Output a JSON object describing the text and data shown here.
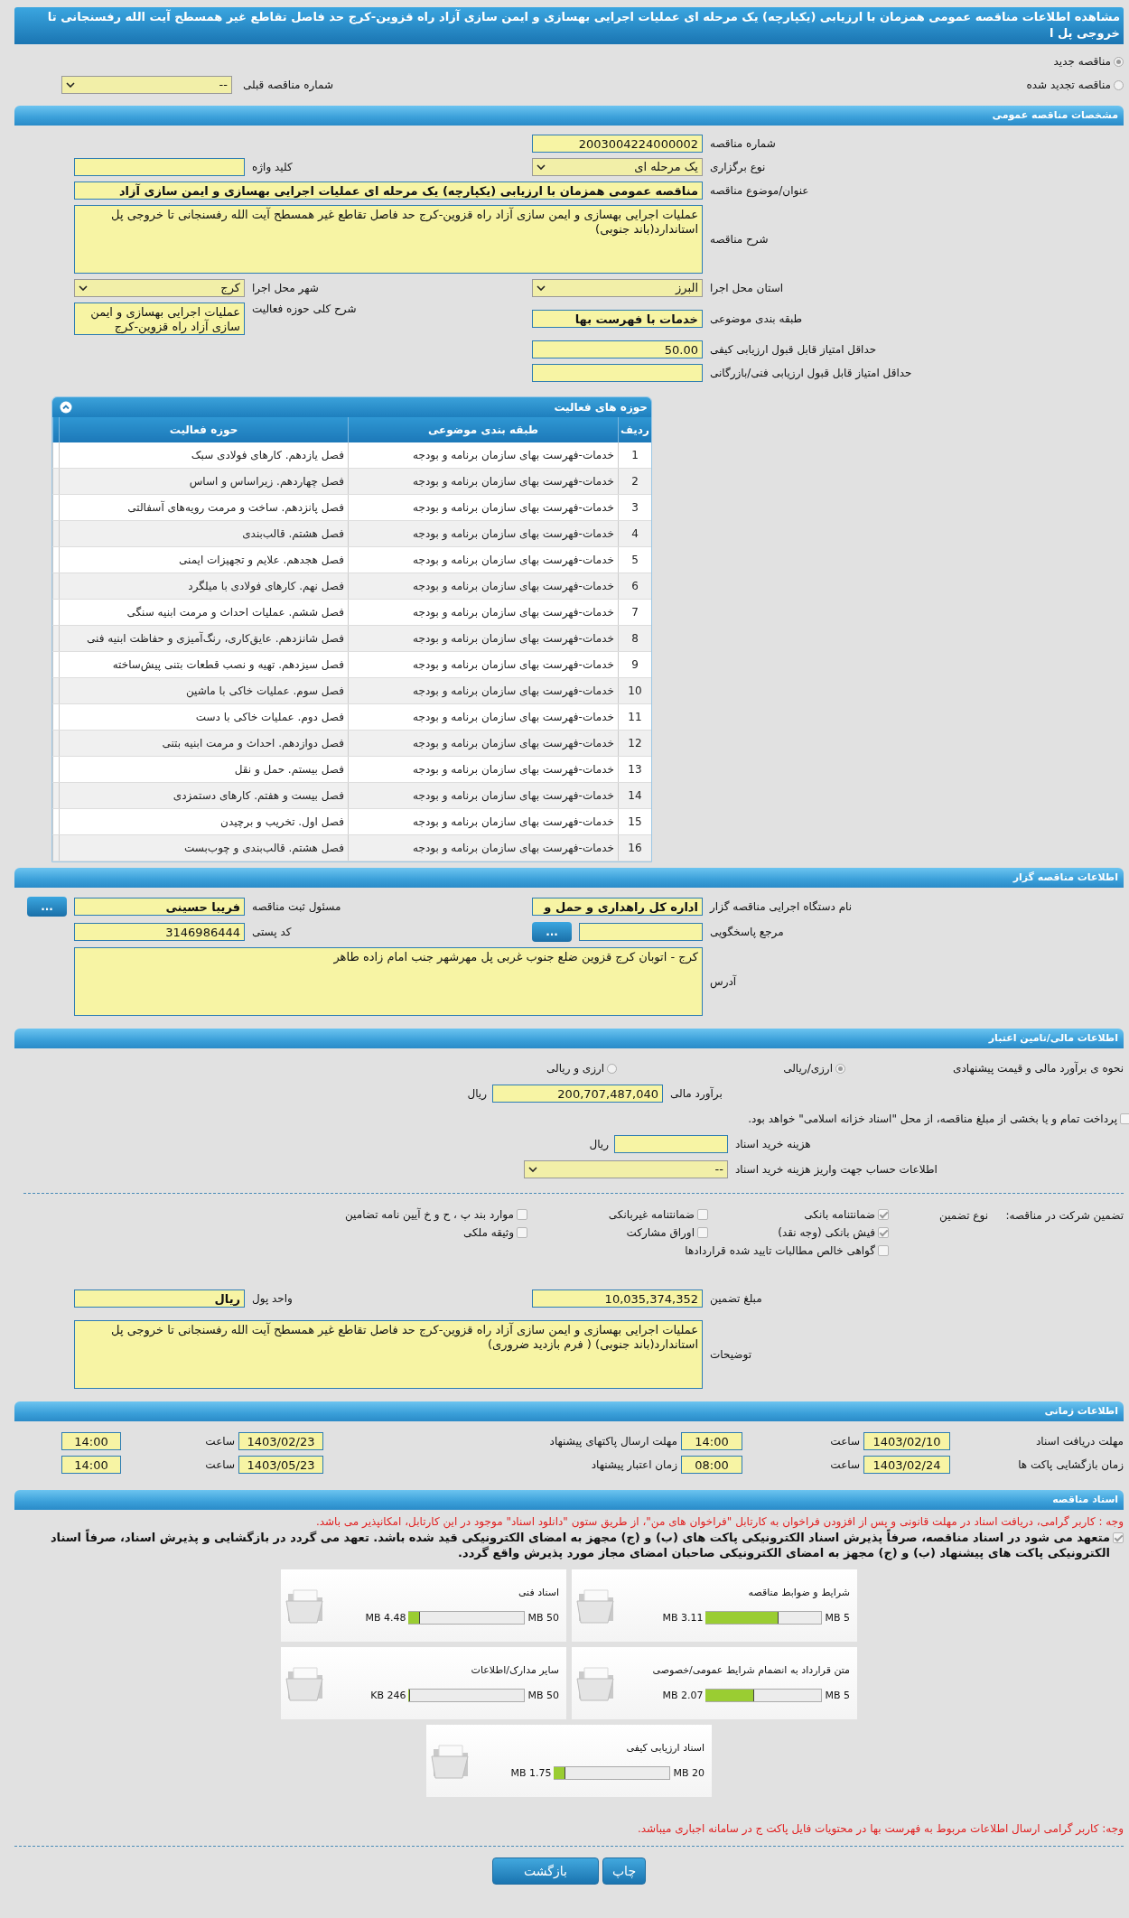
{
  "title": "مشاهده اطلاعات مناقصه عمومی همزمان با ارزیابی (یکپارچه) یک مرحله ای عملیات اجرایی بهسازی و ایمن سازی آزاد راه قزوین-کرج حد فاصل تقاطع غیر همسطح آیت الله رفسنجانی تا خروجی پل ا",
  "tender_kind": [
    {
      "label": "مناقصه جدید",
      "selected": true
    },
    {
      "label": "مناقصه تجدید شده",
      "selected": false
    }
  ],
  "previous_tender": {
    "label": "شماره مناقصه قبلی",
    "value": "--"
  },
  "general": {
    "title": "مشخصات مناقصه عمومی",
    "rows": [
      [
        {
          "kind": "text",
          "label": "شماره مناقصه",
          "value": "2003004224000002"
        }
      ],
      [
        {
          "kind": "select",
          "label": "نوع برگزاری",
          "value": "یک مرحله ای"
        },
        {
          "kind": "text",
          "label": "کلید واژه"
        }
      ],
      [
        {
          "kind": "wide",
          "label": "عنوان/موضوع مناقصه",
          "value": "مناقصه عمومی همزمان با ارزیابی (یکپارچه) یک مرحله ای عملیات اجرایی بهسازی و ایمن سازی آزاد",
          "bold": true
        }
      ],
      [
        {
          "kind": "textarea",
          "label": "شرح مناقصه",
          "value": "عملیات اجرایی بهسازی و ایمن سازی آزاد راه قزوین-کرج حد فاصل تقاطع غیر همسطح آیت الله رفسنجانی تا خروجی پل استاندارد(باند جنوبی)"
        }
      ],
      [
        {
          "kind": "select",
          "label": "استان محل اجرا",
          "value": "البرز"
        },
        {
          "kind": "select",
          "label": "شهر محل اجرا",
          "value": "کرج"
        }
      ],
      [
        {
          "kind": "text",
          "label": "طبقه بندی موضوعی",
          "value": "خدمات با فهرست بها",
          "bold": true
        },
        {
          "kind": "smallarea",
          "label": "شرح کلی حوزه فعالیت",
          "value": "عملیات اجرایی بهسازی و ایمن سازی آزاد راه قزوین-کرج"
        }
      ],
      [
        {
          "kind": "text",
          "label": "حداقل امتیاز قابل قبول ارزیابی کیفی",
          "value": "50.00"
        }
      ],
      [
        {
          "kind": "text",
          "label": "حداقل امتیاز قابل قبول ارزیابی فنی/بازرگانی"
        }
      ]
    ]
  },
  "activities": {
    "title": "حوزه های فعالیت",
    "expanded": true,
    "columns": [
      "ردیف",
      "طبقه بندی موضوعی",
      "حوزه فعالیت"
    ],
    "rows": [
      [
        "1",
        "خدمات-فهرست بهای سازمان برنامه و بودجه",
        "فصل یازدهم. کارهای فولادی سبک"
      ],
      [
        "2",
        "خدمات-فهرست بهای سازمان برنامه و بودجه",
        "فصل چهاردهم. زیراساس و اساس"
      ],
      [
        "3",
        "خدمات-فهرست بهای سازمان برنامه و بودجه",
        "فصل پانزدهم. ساخت و مرمت رویه‌های آسفالتی"
      ],
      [
        "4",
        "خدمات-فهرست بهای سازمان برنامه و بودجه",
        "فصل هشتم. قالب‌بندی"
      ],
      [
        "5",
        "خدمات-فهرست بهای سازمان برنامه و بودجه",
        "فصل هجدهم. علایم و تجهیزات ایمنی"
      ],
      [
        "6",
        "خدمات-فهرست بهای سازمان برنامه و بودجه",
        "فصل نهم. کارهای فولادی با میلگرد"
      ],
      [
        "7",
        "خدمات-فهرست بهای سازمان برنامه و بودجه",
        "فصل ششم.  عملیات احداث و مرمت ابنیه سنگی"
      ],
      [
        "8",
        "خدمات-فهرست بهای سازمان برنامه و بودجه",
        "فصل شانزدهم. عایق‌کاری، رنگ‌آمیزی و حفاظت ابنیه فنی"
      ],
      [
        "9",
        "خدمات-فهرست بهای سازمان برنامه و بودجه",
        "فصل سیزدهم. تهیه و نصب قطعات بتنی پیش‌ساخته"
      ],
      [
        "10",
        "خدمات-فهرست بهای سازمان برنامه و بودجه",
        "فصل سوم. عملیات خاکی با ماشین"
      ],
      [
        "11",
        "خدمات-فهرست بهای سازمان برنامه و بودجه",
        "فصل دوم. عملیات خاکی با دست"
      ],
      [
        "12",
        "خدمات-فهرست بهای سازمان برنامه و بودجه",
        "فصل دوازدهم. احداث و مرمت ابنیه بتنی"
      ],
      [
        "13",
        "خدمات-فهرست بهای سازمان برنامه و بودجه",
        "فصل بیستم. حمل و نقل"
      ],
      [
        "14",
        "خدمات-فهرست بهای سازمان برنامه و بودجه",
        "فصل بیست و هفتم. کارهای دستمزدی"
      ],
      [
        "15",
        "خدمات-فهرست بهای سازمان برنامه و بودجه",
        "فصل اول. تخریب و برچیدن"
      ],
      [
        "16",
        "خدمات-فهرست بهای سازمان برنامه و بودجه",
        "فصل هشتم. قالب‌بندی و چوب‌بست"
      ]
    ]
  },
  "organizer": {
    "title": "اطلاعات مناقصه گزار",
    "rows": [
      [
        {
          "kind": "text",
          "label": "نام دستگاه اجرایی مناقصه گزار",
          "value": "اداره کل راهداری و حمل و",
          "bold": true
        },
        {
          "kind": "text",
          "label": "مسئول ثبت مناقصه",
          "value": "فریبا حسینی",
          "bold": true,
          "button": "..."
        }
      ],
      [
        {
          "kind": "text",
          "label": "مرجع پاسخگویی",
          "button": "..."
        },
        {
          "kind": "text",
          "label": "کد پستی",
          "value": "3146986444"
        }
      ],
      [
        {
          "kind": "textarea",
          "label": "آدرس",
          "value": "کرج - اتوبان کرج قزوین ضلع جنوب غربی پل مهرشهر جنب امام زاده طاهر"
        }
      ]
    ]
  },
  "finance": {
    "title": "اطلاعات مالی/تامین اعتبار",
    "estimate_method": {
      "label": "نحوه ی برآورد مالی و قیمت پیشنهادی",
      "options": [
        {
          "label": "ارزی/ریالی",
          "selected": true
        },
        {
          "label": "ارزی و ریالی",
          "selected": false
        }
      ]
    },
    "estimate": {
      "label": "برآورد مالی",
      "value": "200,707,487,040",
      "unit": "ریال"
    },
    "treasury": {
      "label": "پرداخت تمام و یا بخشی از مبلغ مناقصه، از محل \"اسناد خزانه اسلامی\" خواهد بود.",
      "checked": false
    },
    "doc_fee": {
      "label": "هزینه خرید اسناد",
      "unit": "ریال"
    },
    "account": {
      "label": "اطلاعات حساب جهت واریز هزینه خرید اسناد",
      "value": "--"
    },
    "guarantee": {
      "label": "تضمین شرکت در مناقصه:",
      "type_label": "نوع تضمین",
      "options": [
        {
          "label": "ضمانتنامه بانکی",
          "checked": true
        },
        {
          "label": "ضمانتنامه غیربانکی",
          "checked": false
        },
        {
          "label": "موارد بند پ ، ح و خ آیین نامه تضامین",
          "checked": false
        },
        {
          "label": "فیش بانکی (وجه نقد)",
          "checked": true
        },
        {
          "label": "اوراق مشارکت",
          "checked": false
        },
        {
          "label": "وثیقه ملکی",
          "checked": false
        },
        {
          "label": "گواهی خالص مطالبات تایید شده قراردادها",
          "checked": false
        }
      ]
    },
    "rows": [
      [
        {
          "kind": "text",
          "label": "مبلغ تضمین",
          "value": "10,035,374,352"
        },
        {
          "kind": "text",
          "label": "واحد پول",
          "value": "ریال",
          "bold": true
        }
      ],
      [
        {
          "kind": "textarea",
          "label": "توضیحات",
          "value": "عملیات اجرایی بهسازی و ایمن سازی آزاد راه قزوین-کرج حد فاصل تقاطع غیر همسطح آیت الله رفسنجانی تا خروجی پل استاندارد(باند جنوبی) ( فرم بازدید ضروری)"
        }
      ]
    ]
  },
  "schedule": {
    "title": "اطلاعات زمانی",
    "items": [
      {
        "label": "مهلت دریافت اسناد",
        "date": "1403/02/10",
        "time_label": "ساعت",
        "time": "14:00"
      },
      {
        "label": "مهلت ارسال پاکتهای پیشنهاد",
        "date": "1403/02/23",
        "time_label": "ساعت",
        "time": "14:00"
      },
      {
        "label": "زمان بازگشایی پاکت ها",
        "date": "1403/02/24",
        "time_label": "ساعت",
        "time": "08:00"
      },
      {
        "label": "زمان اعتبار پیشنهاد",
        "date": "1403/05/23",
        "time_label": "ساعت",
        "time": "14:00"
      }
    ]
  },
  "documents": {
    "title": "اسناد مناقصه",
    "notice": "وجه : کاربر گرامی، دریافت اسناد در مهلت قانونی و پس از افزودن فراخوان به کارتابل \"فراخوان های من\"، از طریق ستون \"دانلود اسناد\" موجود در این کارتابل، امکانپذیر می باشد.",
    "commitment": {
      "label": "متعهد می شود در اسناد مناقصه، صرفاً پذیرش اسناد الکترونیکی پاکت های (ب) و (ج) مجهز به امضای الکترونیکی قید شده باشد. تعهد می گردد در بازگشایی و پذیرش اسناد، صرفاً اسناد الکترونیکی پاکت های پیشنهاد (ب) و (ج) مجهز به امضای الکترونیکی صاحبان امضای مجاز مورد پذیرش واقع گردد.",
      "checked": true
    },
    "files": [
      {
        "name": "شرایط و ضوابط مناقصه",
        "max": "5 MB",
        "used": "3.11 MB",
        "level": 0.622
      },
      {
        "name": "اسناد فنی",
        "max": "50 MB",
        "used": "4.48 MB",
        "level": 0.09
      },
      {
        "name": "متن قرارداد به انضمام شرایط عمومی/خصوصی",
        "max": "5 MB",
        "used": "2.07 MB",
        "level": 0.414
      },
      {
        "name": "سایر مدارک/اطلاعات",
        "max": "50 MB",
        "used": "246 KB",
        "level": 0.005
      },
      {
        "name": "اسناد ارزیابی کیفی",
        "max": "20 MB",
        "used": "1.75 MB",
        "level": 0.0875
      }
    ],
    "footer_notice": "وجه: کاربر گرامی ارسال اطلاعات مربوط به فهرست بها در محتویات فایل پاکت ج در سامانه اجباری میباشد."
  },
  "buttons": [
    {
      "label": "چاپ"
    },
    {
      "label": "بازگشت"
    }
  ]
}
